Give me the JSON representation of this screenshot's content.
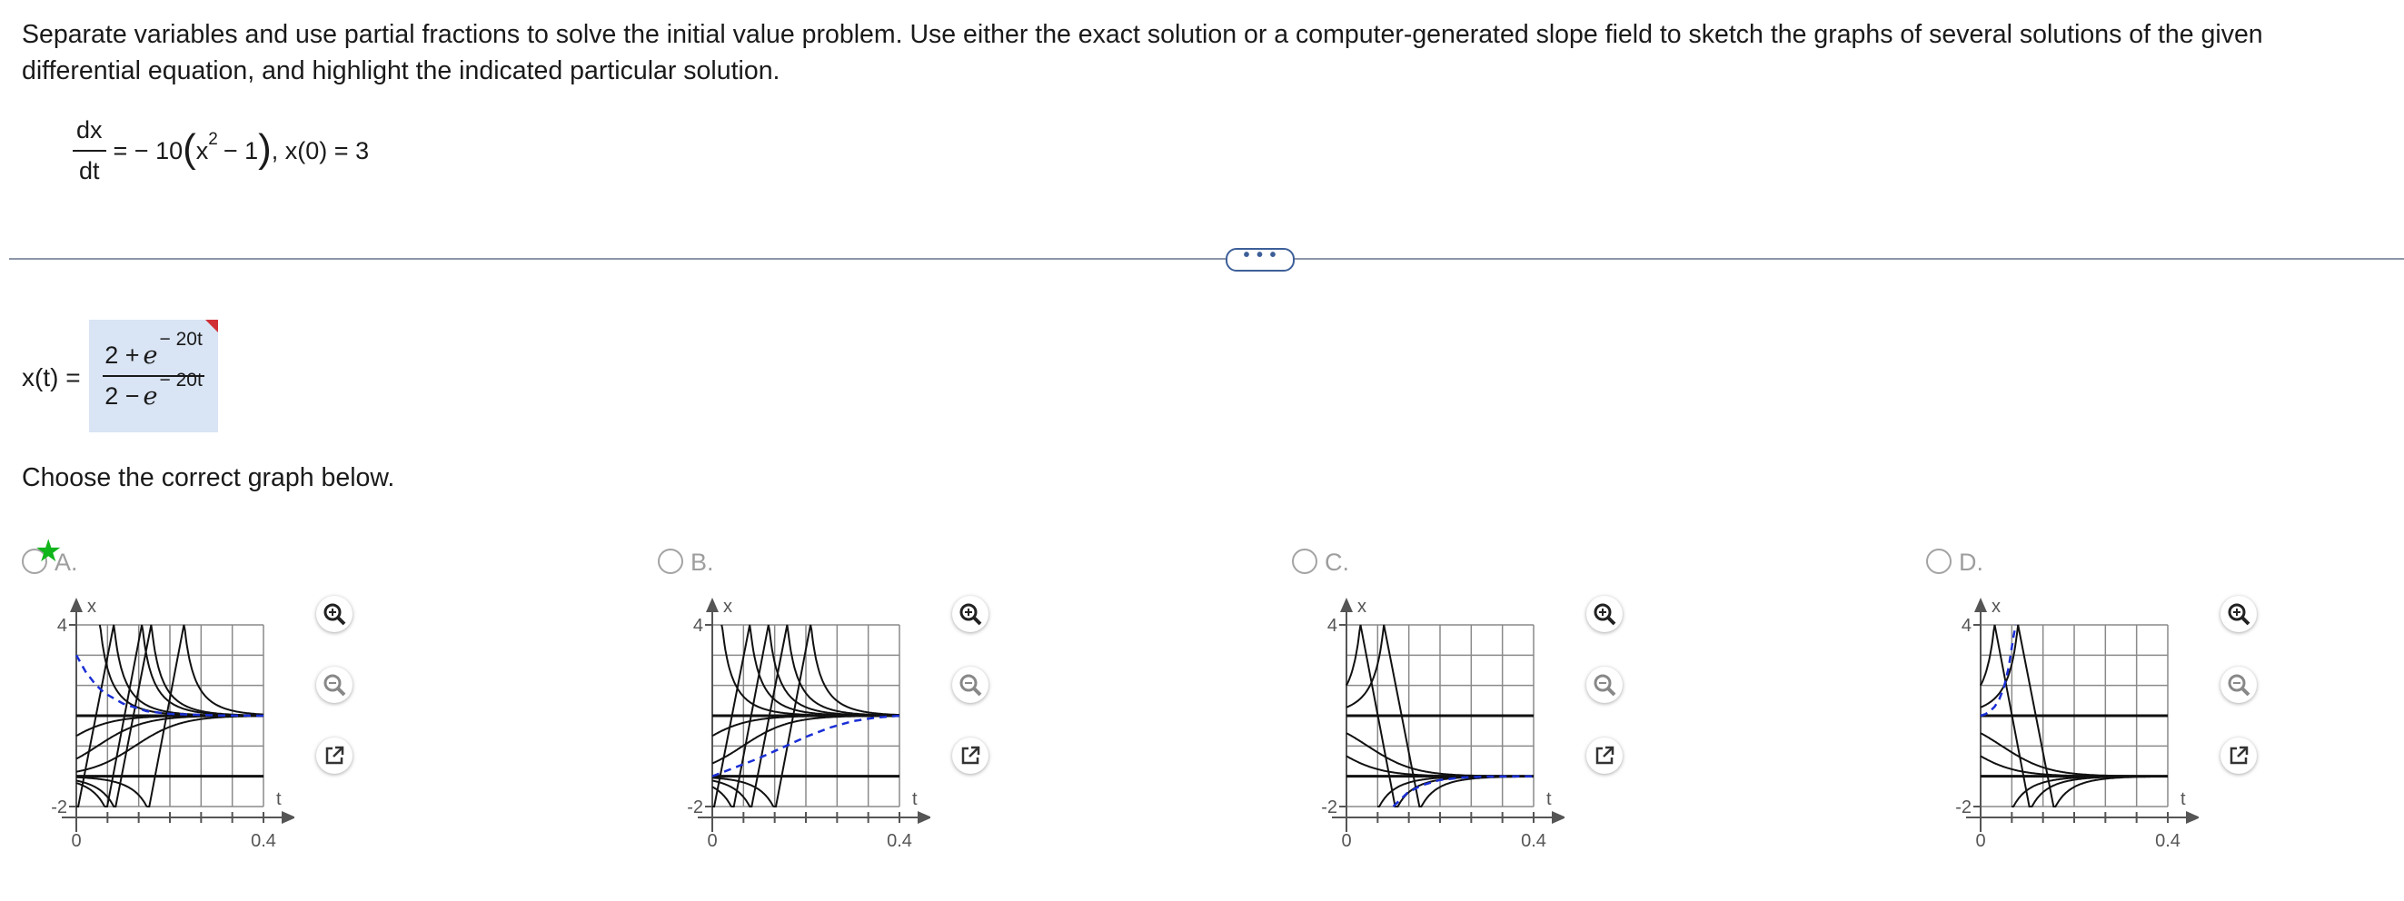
{
  "problem": {
    "instruction": "Separate variables and use partial fractions to solve the initial value problem. Use either the exact solution or a computer-generated slope field to sketch the graphs of several solutions of the given differential equation, and highlight the indicated particular solution.",
    "ode_num": "dx",
    "ode_den": "dt",
    "ode_eq": "= − 10",
    "ode_x": "x",
    "ode_power": "2",
    "ode_minus_one": "− 1",
    "ode_ic": ", x(0) = 3"
  },
  "more_button": "• • •",
  "answer": {
    "label": "x(t) =",
    "num_left": "2 +",
    "den_left": "2 −",
    "e": "e",
    "exponent": "− 20t"
  },
  "prompt": "Choose the correct graph below.",
  "choices": [
    {
      "letter": "A.",
      "selected": true,
      "particular": [
        [
          0,
          3.0
        ],
        [
          0.02,
          2.45
        ],
        [
          0.04,
          2.05
        ],
        [
          0.06,
          1.75
        ],
        [
          0.1,
          1.4
        ],
        [
          0.15,
          1.15
        ],
        [
          0.2,
          1.06
        ],
        [
          0.3,
          1.01
        ],
        [
          0.4,
          1.0
        ]
      ]
    },
    {
      "letter": "B.",
      "selected": false,
      "particular": [
        [
          0,
          -1.0
        ],
        [
          0.05,
          -0.7
        ],
        [
          0.1,
          -0.4
        ],
        [
          0.15,
          -0.05
        ],
        [
          0.2,
          0.3
        ],
        [
          0.25,
          0.6
        ],
        [
          0.3,
          0.82
        ],
        [
          0.35,
          0.94
        ],
        [
          0.4,
          1.0
        ]
      ]
    },
    {
      "letter": "C.",
      "selected": false,
      "particular": [
        [
          0.1,
          -2.0
        ],
        [
          0.13,
          -1.55
        ],
        [
          0.16,
          -1.3
        ],
        [
          0.2,
          -1.12
        ],
        [
          0.25,
          -1.04
        ],
        [
          0.3,
          -1.01
        ],
        [
          0.4,
          -1.0
        ]
      ]
    },
    {
      "letter": "D.",
      "selected": false,
      "particular": [
        [
          0,
          1.0
        ],
        [
          0.01,
          1.05
        ],
        [
          0.02,
          1.15
        ],
        [
          0.03,
          1.3
        ],
        [
          0.04,
          1.55
        ],
        [
          0.05,
          1.95
        ],
        [
          0.06,
          2.6
        ],
        [
          0.07,
          3.6
        ],
        [
          0.075,
          4.0
        ]
      ]
    }
  ],
  "axes": {
    "x_label": "x",
    "t_label": "t",
    "x_top": "4",
    "x_bottom": "-2",
    "t_zero": "0",
    "t_end": "0.4"
  },
  "colors": {
    "particular": "#1a2fd6",
    "curves": "#111111",
    "grid": "#8a8a8a",
    "selected_star": "#10b51b"
  },
  "tools": {
    "zoom_in": "zoom-in",
    "zoom_out": "zoom-out",
    "open": "open-in-new-window"
  }
}
